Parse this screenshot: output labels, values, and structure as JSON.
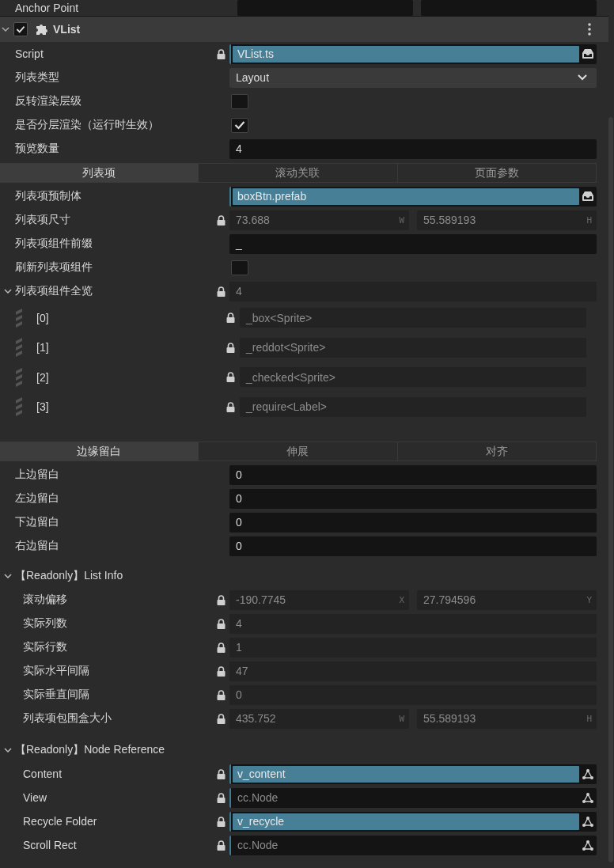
{
  "anchor_point": {
    "label": "Anchor Point"
  },
  "component": {
    "title": "VList",
    "enabled": true,
    "expanded": true,
    "rows": [
      {
        "kind": "prop",
        "label": "Script",
        "locked": true,
        "field": {
          "kind": "asset",
          "value": "VList.ts"
        }
      },
      {
        "kind": "prop",
        "label": "列表类型",
        "locked": false,
        "field": {
          "kind": "select",
          "value": "Layout"
        }
      },
      {
        "kind": "prop",
        "label": "反转渲染层级",
        "locked": false,
        "field": {
          "kind": "checkbox",
          "checked": false
        }
      },
      {
        "kind": "prop",
        "label": "是否分层渲染（运行时生效）",
        "locked": false,
        "field": {
          "kind": "checkbox",
          "checked": true
        }
      },
      {
        "kind": "prop",
        "label": "预览数量",
        "locked": false,
        "field": {
          "kind": "text",
          "value": "4"
        }
      },
      {
        "kind": "tabs",
        "tabs": [
          {
            "label": "列表项",
            "selected": true
          },
          {
            "label": "滚动关联",
            "selected": false
          },
          {
            "label": "页面参数",
            "selected": false
          }
        ]
      },
      {
        "kind": "prop",
        "label": "列表项预制体",
        "locked": false,
        "field": {
          "kind": "asset",
          "value": "boxBtn.prefab"
        }
      },
      {
        "kind": "prop",
        "label": "列表项尺寸",
        "locked": true,
        "field": {
          "kind": "vec2",
          "parts": [
            {
              "value": "73.688",
              "axis": "W"
            },
            {
              "value": "55.589193",
              "axis": "H"
            }
          ]
        }
      },
      {
        "kind": "prop",
        "label": "列表项组件前缀",
        "locked": false,
        "field": {
          "kind": "text",
          "value": "_"
        }
      },
      {
        "kind": "prop",
        "label": "刷新列表项组件",
        "locked": false,
        "field": {
          "kind": "checkbox",
          "checked": false
        }
      },
      {
        "kind": "prop",
        "label": "列表项组件全览",
        "locked": true,
        "expanded": true,
        "field": {
          "kind": "text",
          "value": "4"
        },
        "children": [
          {
            "kind": "element",
            "label": "[0]",
            "locked": true,
            "field": {
              "kind": "text",
              "value": "_box<Sprite>"
            }
          },
          {
            "kind": "element",
            "label": "[1]",
            "locked": true,
            "field": {
              "kind": "text",
              "value": "_reddot<Sprite>"
            }
          },
          {
            "kind": "element",
            "label": "[2]",
            "locked": true,
            "field": {
              "kind": "text",
              "value": "_checked<Sprite>"
            }
          },
          {
            "kind": "element",
            "label": "[3]",
            "locked": true,
            "field": {
              "kind": "text",
              "value": "_require<Label>"
            }
          }
        ]
      },
      {
        "kind": "tabs",
        "tabs": [
          {
            "label": "边缘留白",
            "selected": true
          },
          {
            "label": "伸展",
            "selected": false
          },
          {
            "label": "对齐",
            "selected": false
          }
        ]
      },
      {
        "kind": "prop",
        "label": "上边留白",
        "locked": false,
        "field": {
          "kind": "text",
          "value": "0"
        }
      },
      {
        "kind": "prop",
        "label": "左边留白",
        "locked": false,
        "field": {
          "kind": "text",
          "value": "0"
        }
      },
      {
        "kind": "prop",
        "label": "下边留白",
        "locked": false,
        "field": {
          "kind": "text",
          "value": "0"
        }
      },
      {
        "kind": "prop",
        "label": "右边留白",
        "locked": false,
        "field": {
          "kind": "text",
          "value": "0"
        }
      },
      {
        "kind": "group",
        "label": "【Readonly】List Info",
        "expanded": true,
        "children": [
          {
            "kind": "prop",
            "label": "滚动偏移",
            "locked": true,
            "field": {
              "kind": "vec2",
              "parts": [
                {
                  "value": "-190.7745",
                  "axis": "X"
                },
                {
                  "value": "27.794596",
                  "axis": "Y"
                }
              ]
            }
          },
          {
            "kind": "prop",
            "label": "实际列数",
            "locked": true,
            "field": {
              "kind": "text",
              "value": "4"
            }
          },
          {
            "kind": "prop",
            "label": "实际行数",
            "locked": true,
            "field": {
              "kind": "text",
              "value": "1"
            }
          },
          {
            "kind": "prop",
            "label": "实际水平间隔",
            "locked": true,
            "field": {
              "kind": "text",
              "value": "47"
            }
          },
          {
            "kind": "prop",
            "label": "实际垂直间隔",
            "locked": true,
            "field": {
              "kind": "text",
              "value": "0"
            }
          },
          {
            "kind": "prop",
            "label": "列表项包围盒大小",
            "locked": true,
            "field": {
              "kind": "vec2",
              "parts": [
                {
                  "value": "435.752",
                  "axis": "W"
                },
                {
                  "value": "55.589193",
                  "axis": "H"
                }
              ]
            }
          }
        ]
      },
      {
        "kind": "group",
        "label": "【Readonly】Node Reference",
        "expanded": true,
        "children": [
          {
            "kind": "prop",
            "label": "Content",
            "locked": true,
            "field": {
              "kind": "node",
              "value": "v_content",
              "assigned": true
            }
          },
          {
            "kind": "prop",
            "label": "View",
            "locked": true,
            "field": {
              "kind": "node",
              "value": "cc.Node",
              "assigned": false
            }
          },
          {
            "kind": "prop",
            "label": "Recycle Folder",
            "locked": true,
            "field": {
              "kind": "node",
              "value": "v_recycle",
              "assigned": true
            }
          },
          {
            "kind": "prop",
            "label": "Scroll Rect",
            "locked": true,
            "field": {
              "kind": "node",
              "value": "cc.Node",
              "assigned": false
            }
          }
        ]
      }
    ]
  }
}
